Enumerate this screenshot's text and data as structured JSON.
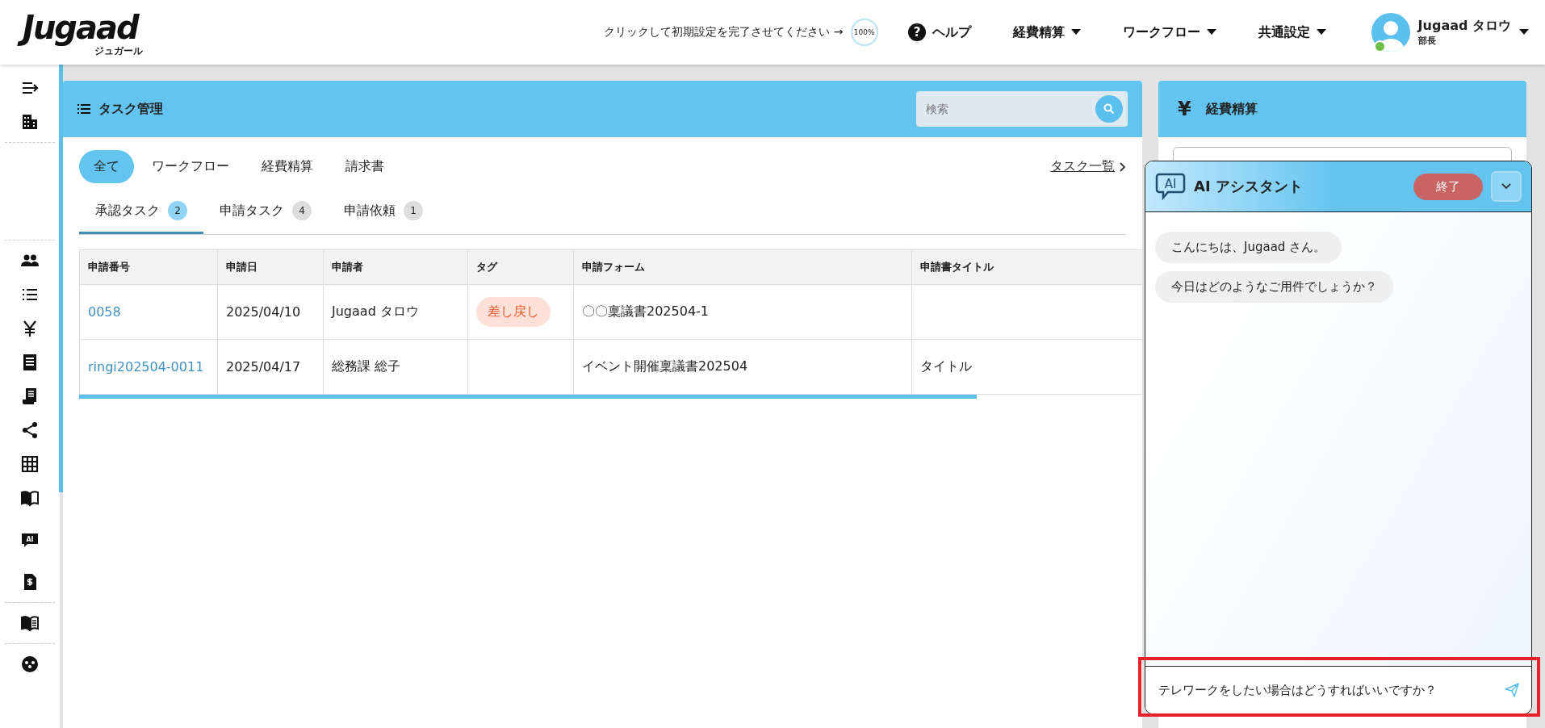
{
  "header": {
    "logo": "Jugaad",
    "logo_sub": "ジュガール",
    "setup_prompt": "クリックして初期設定を完了させてください →",
    "setup_progress": {
      "text": "100%",
      "level": 1
    },
    "help_icon": "?",
    "help": "ヘルプ",
    "menus": [
      "経費精算",
      "ワークフロー",
      "共通設定"
    ],
    "user": {
      "name": "Jugaad タロウ",
      "role": "部長",
      "online": true
    }
  },
  "sidebar": {
    "ai_icon_label": "AI"
  },
  "task_panel": {
    "title": "タスク管理",
    "search": {
      "placeholder": "検索"
    },
    "filters": [
      {
        "label": "全て",
        "selected": true
      },
      {
        "label": "ワークフロー",
        "selected": false
      },
      {
        "label": "経費精算",
        "selected": false
      },
      {
        "label": "請求書",
        "selected": false
      }
    ],
    "task_list_link": "タスク一覧",
    "tabs": [
      {
        "label": "承認タスク",
        "count": "2",
        "selected": true
      },
      {
        "label": "申請タスク",
        "count": "4",
        "selected": false
      },
      {
        "label": "申請依頼",
        "count": "1",
        "selected": false
      }
    ],
    "table": {
      "columns": [
        "申請番号",
        "申請日",
        "申請者",
        "タグ",
        "申請フォーム",
        "申請書タイトル"
      ],
      "rows": [
        {
          "number": "0058",
          "date": "2025/04/10",
          "applicant": "Jugaad タロウ",
          "tag": "差し戻し",
          "form": "〇〇稟議書202504-1"
        },
        {
          "number": "ringi202504-0011",
          "date": "2025/04/17",
          "applicant": "総務課 総子",
          "form": "イベント開催稟議書202504",
          "title": "タイトル"
        }
      ]
    }
  },
  "expense_panel": {
    "icon": "¥",
    "title": "経費精算"
  },
  "assistant": {
    "icon_label": "AI",
    "title": "AI アシスタント",
    "end_button": "終了",
    "messages": [
      "こんにちは、Jugaad さん。",
      "今日はどのようなご用件でしょうか？"
    ],
    "input": {
      "value": "テレワークをしたい場合はどうすればいいですか？"
    }
  }
}
